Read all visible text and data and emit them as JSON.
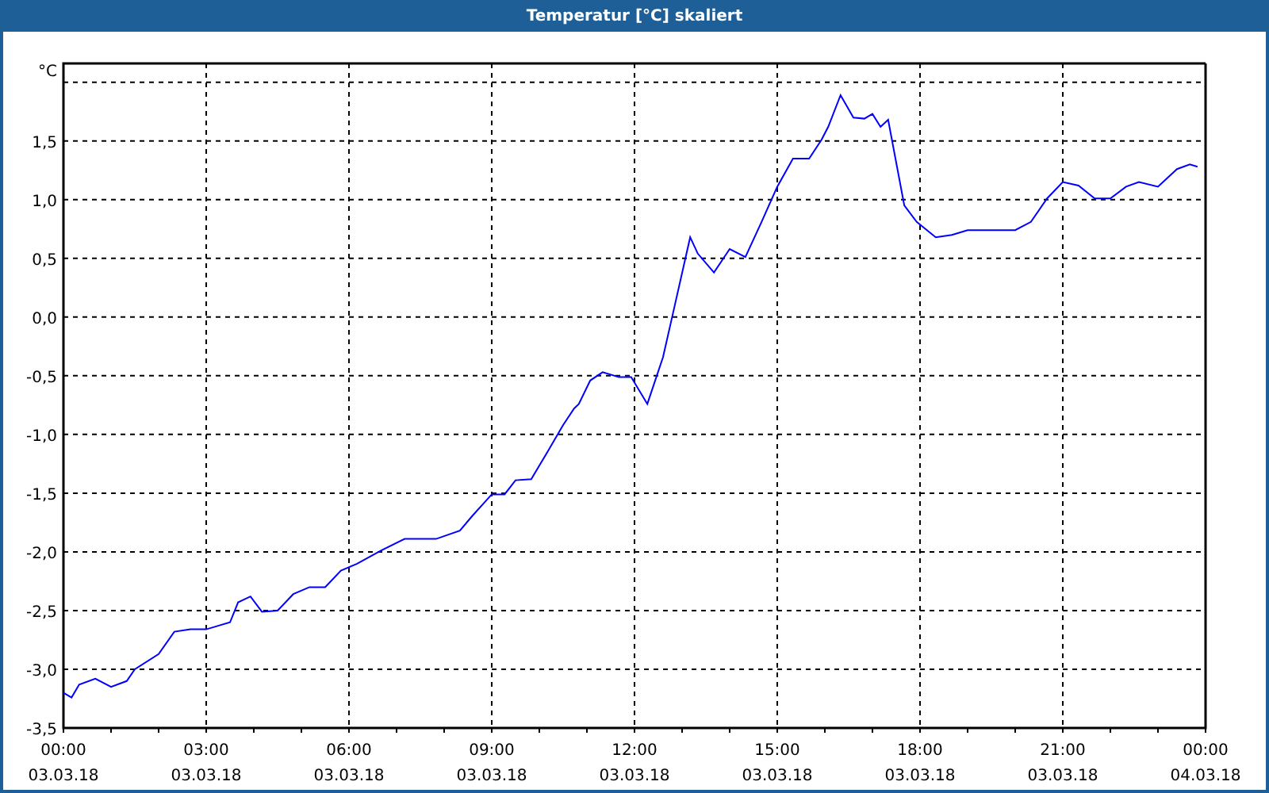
{
  "window": {
    "title": "Temperatur [°C] skaliert"
  },
  "chart": {
    "x_dates": [
      "03.03.18",
      "03.03.18",
      "03.03.18",
      "03.03.18",
      "03.03.18",
      "03.03.18",
      "03.03.18",
      "03.03.18",
      "04.03.18"
    ],
    "chart_data": {
      "type": "line",
      "ylabel": "°C",
      "xlim": [
        0,
        24
      ],
      "ylim": [
        -3.5,
        2.16
      ],
      "grid": true,
      "xticks": [
        {
          "value": 0,
          "label": "00:00"
        },
        {
          "value": 3,
          "label": "03:00"
        },
        {
          "value": 6,
          "label": "06:00"
        },
        {
          "value": 9,
          "label": "09:00"
        },
        {
          "value": 12,
          "label": "12:00"
        },
        {
          "value": 15,
          "label": "15:00"
        },
        {
          "value": 18,
          "label": "18:00"
        },
        {
          "value": 21,
          "label": "21:00"
        },
        {
          "value": 24,
          "label": "00:00"
        }
      ],
      "yticks": [
        {
          "value": -3.5,
          "label": "-3,5"
        },
        {
          "value": -3,
          "label": "-3,0"
        },
        {
          "value": -2.5,
          "label": "-2,5"
        },
        {
          "value": -2,
          "label": "-2,0"
        },
        {
          "value": -1.5,
          "label": "-1,5"
        },
        {
          "value": -1,
          "label": "-1,0"
        },
        {
          "value": -0.5,
          "label": "-0,5"
        },
        {
          "value": 0,
          "label": "0,0"
        },
        {
          "value": 0.5,
          "label": "0,5"
        },
        {
          "value": 1,
          "label": "1,0"
        },
        {
          "value": 1.5,
          "label": "1,5"
        }
      ],
      "x": [
        0,
        0.17,
        0.33,
        0.67,
        1,
        1.33,
        1.5,
        2,
        2.33,
        2.67,
        3,
        3.5,
        3.67,
        3.93,
        4.17,
        4.5,
        4.83,
        5.17,
        5.5,
        5.83,
        6.17,
        6.67,
        7.17,
        7.83,
        8.33,
        8.6,
        9,
        9.27,
        9.5,
        9.83,
        10.17,
        10.5,
        10.73,
        10.83,
        11.07,
        11.33,
        11.67,
        11.93,
        12.27,
        12.6,
        12.83,
        13.17,
        13.33,
        13.67,
        14,
        14.33,
        14.67,
        15,
        15.33,
        15.67,
        15.93,
        16.07,
        16.33,
        16.6,
        16.83,
        17,
        17.17,
        17.33,
        17.67,
        17.93,
        18.33,
        18.67,
        19,
        19.5,
        20,
        20.33,
        20.67,
        21,
        21.33,
        21.67,
        22,
        22.33,
        22.6,
        23,
        23.4,
        23.67,
        23.83
      ],
      "series": [
        {
          "color": "#0000ff",
          "values": [
            -3.2,
            -3.24,
            -3.13,
            -3.08,
            -3.15,
            -3.1,
            -3.0,
            -2.87,
            -2.68,
            -2.66,
            -2.66,
            -2.6,
            -2.43,
            -2.38,
            -2.51,
            -2.5,
            -2.36,
            -2.3,
            -2.3,
            -2.16,
            -2.1,
            -1.99,
            -1.89,
            -1.89,
            -1.82,
            -1.69,
            -1.51,
            -1.51,
            -1.39,
            -1.38,
            -1.15,
            -0.92,
            -0.78,
            -0.74,
            -0.54,
            -0.47,
            -0.51,
            -0.51,
            -0.74,
            -0.34,
            0.07,
            0.68,
            0.54,
            0.38,
            0.58,
            0.51,
            0.81,
            1.11,
            1.35,
            1.35,
            1.51,
            1.62,
            1.89,
            1.7,
            1.69,
            1.73,
            1.62,
            1.68,
            0.95,
            0.81,
            0.68,
            0.7,
            0.74,
            0.74,
            0.74,
            0.81,
            1.01,
            1.15,
            1.12,
            1.01,
            1.01,
            1.11,
            1.15,
            1.11,
            1.26,
            1.3,
            1.28
          ]
        }
      ]
    }
  }
}
